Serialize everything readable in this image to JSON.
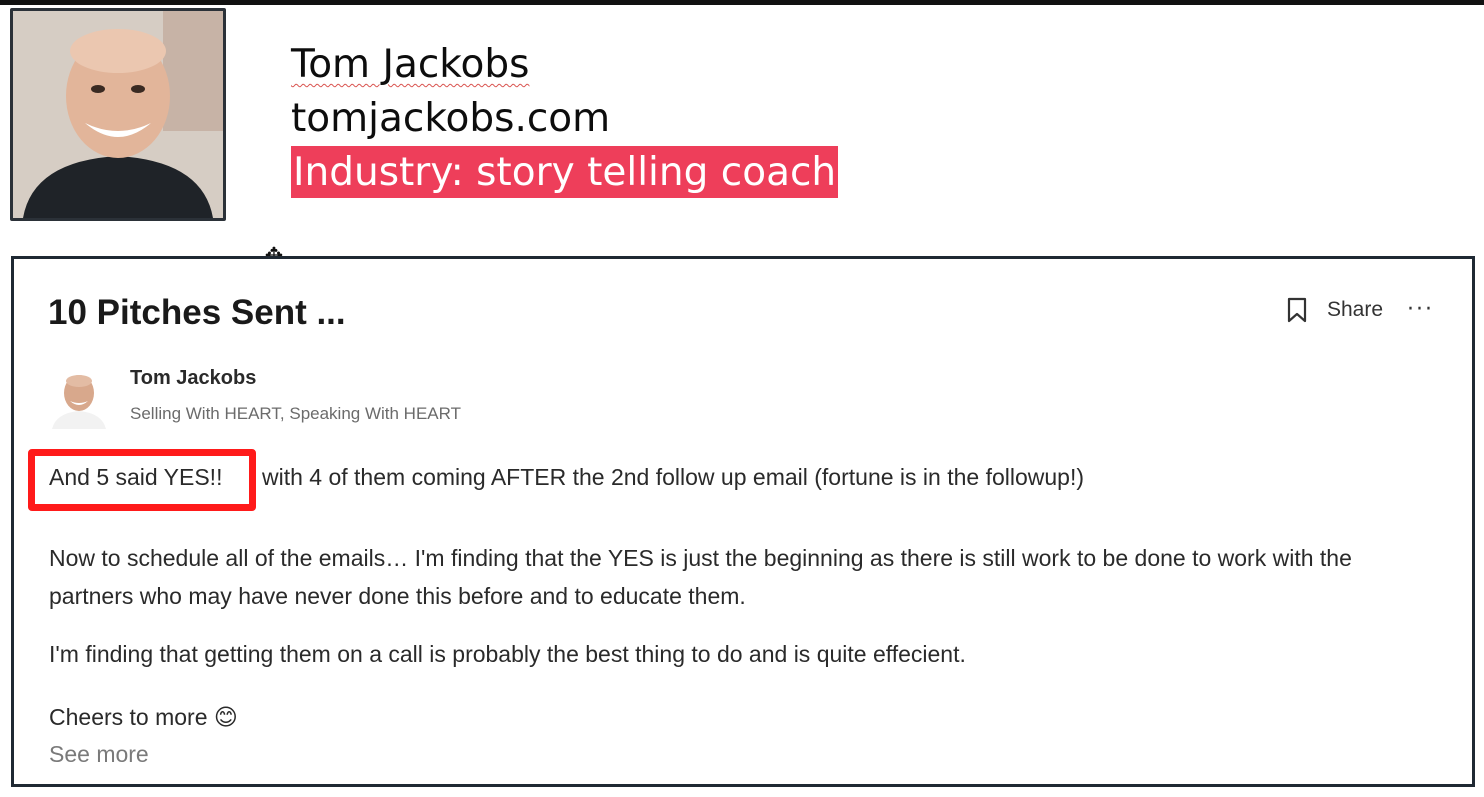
{
  "header": {
    "name": "Tom Jackobs",
    "website": "tomjackobs.com",
    "industry": "Industry: story telling coach"
  },
  "post": {
    "title": "10 Pitches Sent ...",
    "actions": {
      "share_label": "Share",
      "more_label": "···"
    },
    "author": {
      "name": "Tom Jackobs",
      "tagline": "Selling With HEART, Speaking With HEART"
    },
    "paragraph1_highlight": "And 5 said YES!!",
    "paragraph1_rest": "with 4 of them coming AFTER the 2nd follow up email (fortune is in the followup!)",
    "paragraph2": "Now to schedule all of the emails… I'm finding that the YES is just the beginning as there is still work to be done to work with the partners who may have never done this before and to educate them.",
    "paragraph3": "I'm finding that getting them on a call is probably the best thing to do and is quite effecient.",
    "paragraph4": "Cheers to more 😊",
    "see_more": "See more"
  },
  "colors": {
    "industry_highlight": "#ee3e5a",
    "callout_border": "#ff1a1a",
    "card_border": "#1f2933"
  },
  "icons": [
    "move-cursor-icon",
    "bookmark-icon",
    "more-options-icon"
  ]
}
